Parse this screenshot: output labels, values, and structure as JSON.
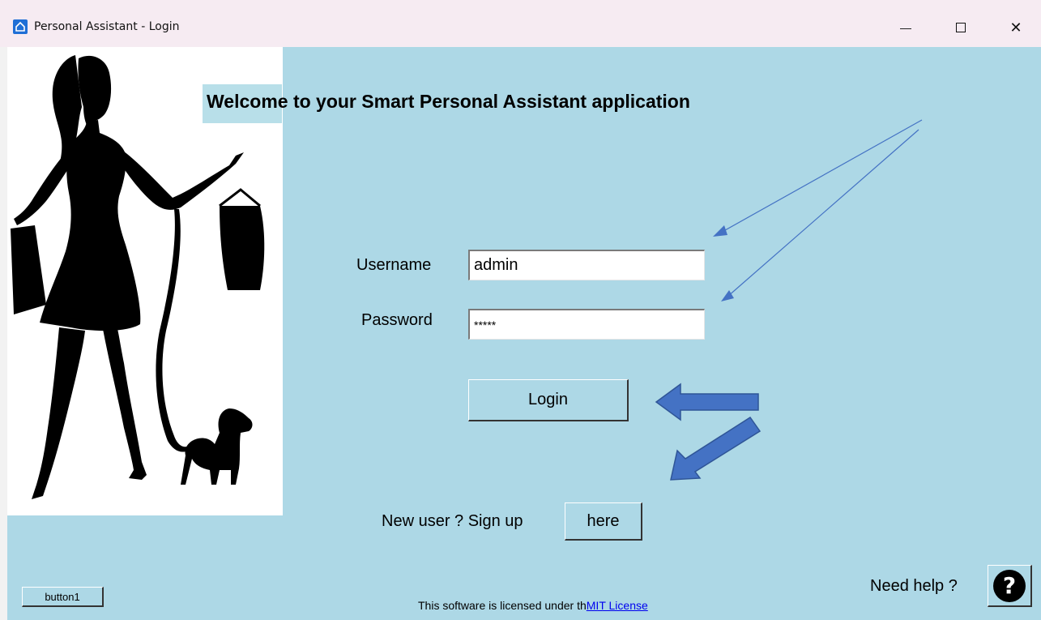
{
  "window": {
    "title": "Personal Assistant - Login",
    "minimize_glyph": "—",
    "close_glyph": "✕"
  },
  "main": {
    "welcome": "Welcome to your Smart  Personal Assistant application",
    "username_label": "Username",
    "username_value": "admin",
    "password_label": "Password",
    "password_value": "*****",
    "login_button": "Login",
    "signup_text": "New user ? Sign up",
    "here_button": "here",
    "button1": "button1",
    "license_text": "This software is licensed under th",
    "license_link": "MIT License",
    "help_text": "Need help ?",
    "help_glyph": "?"
  },
  "icons": {
    "app": "home-icon",
    "help": "question-circle-icon",
    "illustration": "woman-shopping-silhouette-with-dog"
  },
  "colors": {
    "background": "#add8e6",
    "titlebar": "#f6ebf2",
    "annotation_arrow": "#4472c4",
    "link": "#0000ee"
  }
}
